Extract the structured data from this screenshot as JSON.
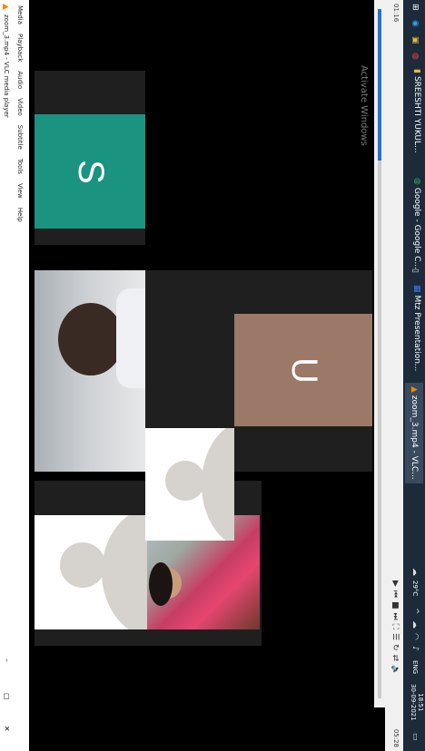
{
  "window": {
    "title": "zoom_3.mp4 - VLC media player",
    "controls": [
      "–",
      "▢",
      "✕"
    ]
  },
  "menubar": [
    "Media",
    "Playback",
    "Audio",
    "Video",
    "Subtitle",
    "Tools",
    "View",
    "Help"
  ],
  "tiles": {
    "s_avatar": {
      "letter": "S",
      "color": "#1a9381"
    },
    "u_avatar": {
      "letter": "U",
      "color": "#9c7868"
    }
  },
  "watermark": "Activate Windows",
  "player": {
    "time_elapsed": "01:16",
    "time_total": "05:28",
    "progress": 0.22
  },
  "taskbar": {
    "apps": [
      {
        "label": "SREESHTI YUKUL..."
      },
      {
        "label": "Google - Google C..."
      },
      {
        "label": "Mtz Presentation..."
      },
      {
        "label": "zoom_3.mp4 - VLC..."
      }
    ],
    "weather": "29°C",
    "lang": "ENG",
    "clock_time": "18:51",
    "clock_date": "30-09-2021"
  }
}
